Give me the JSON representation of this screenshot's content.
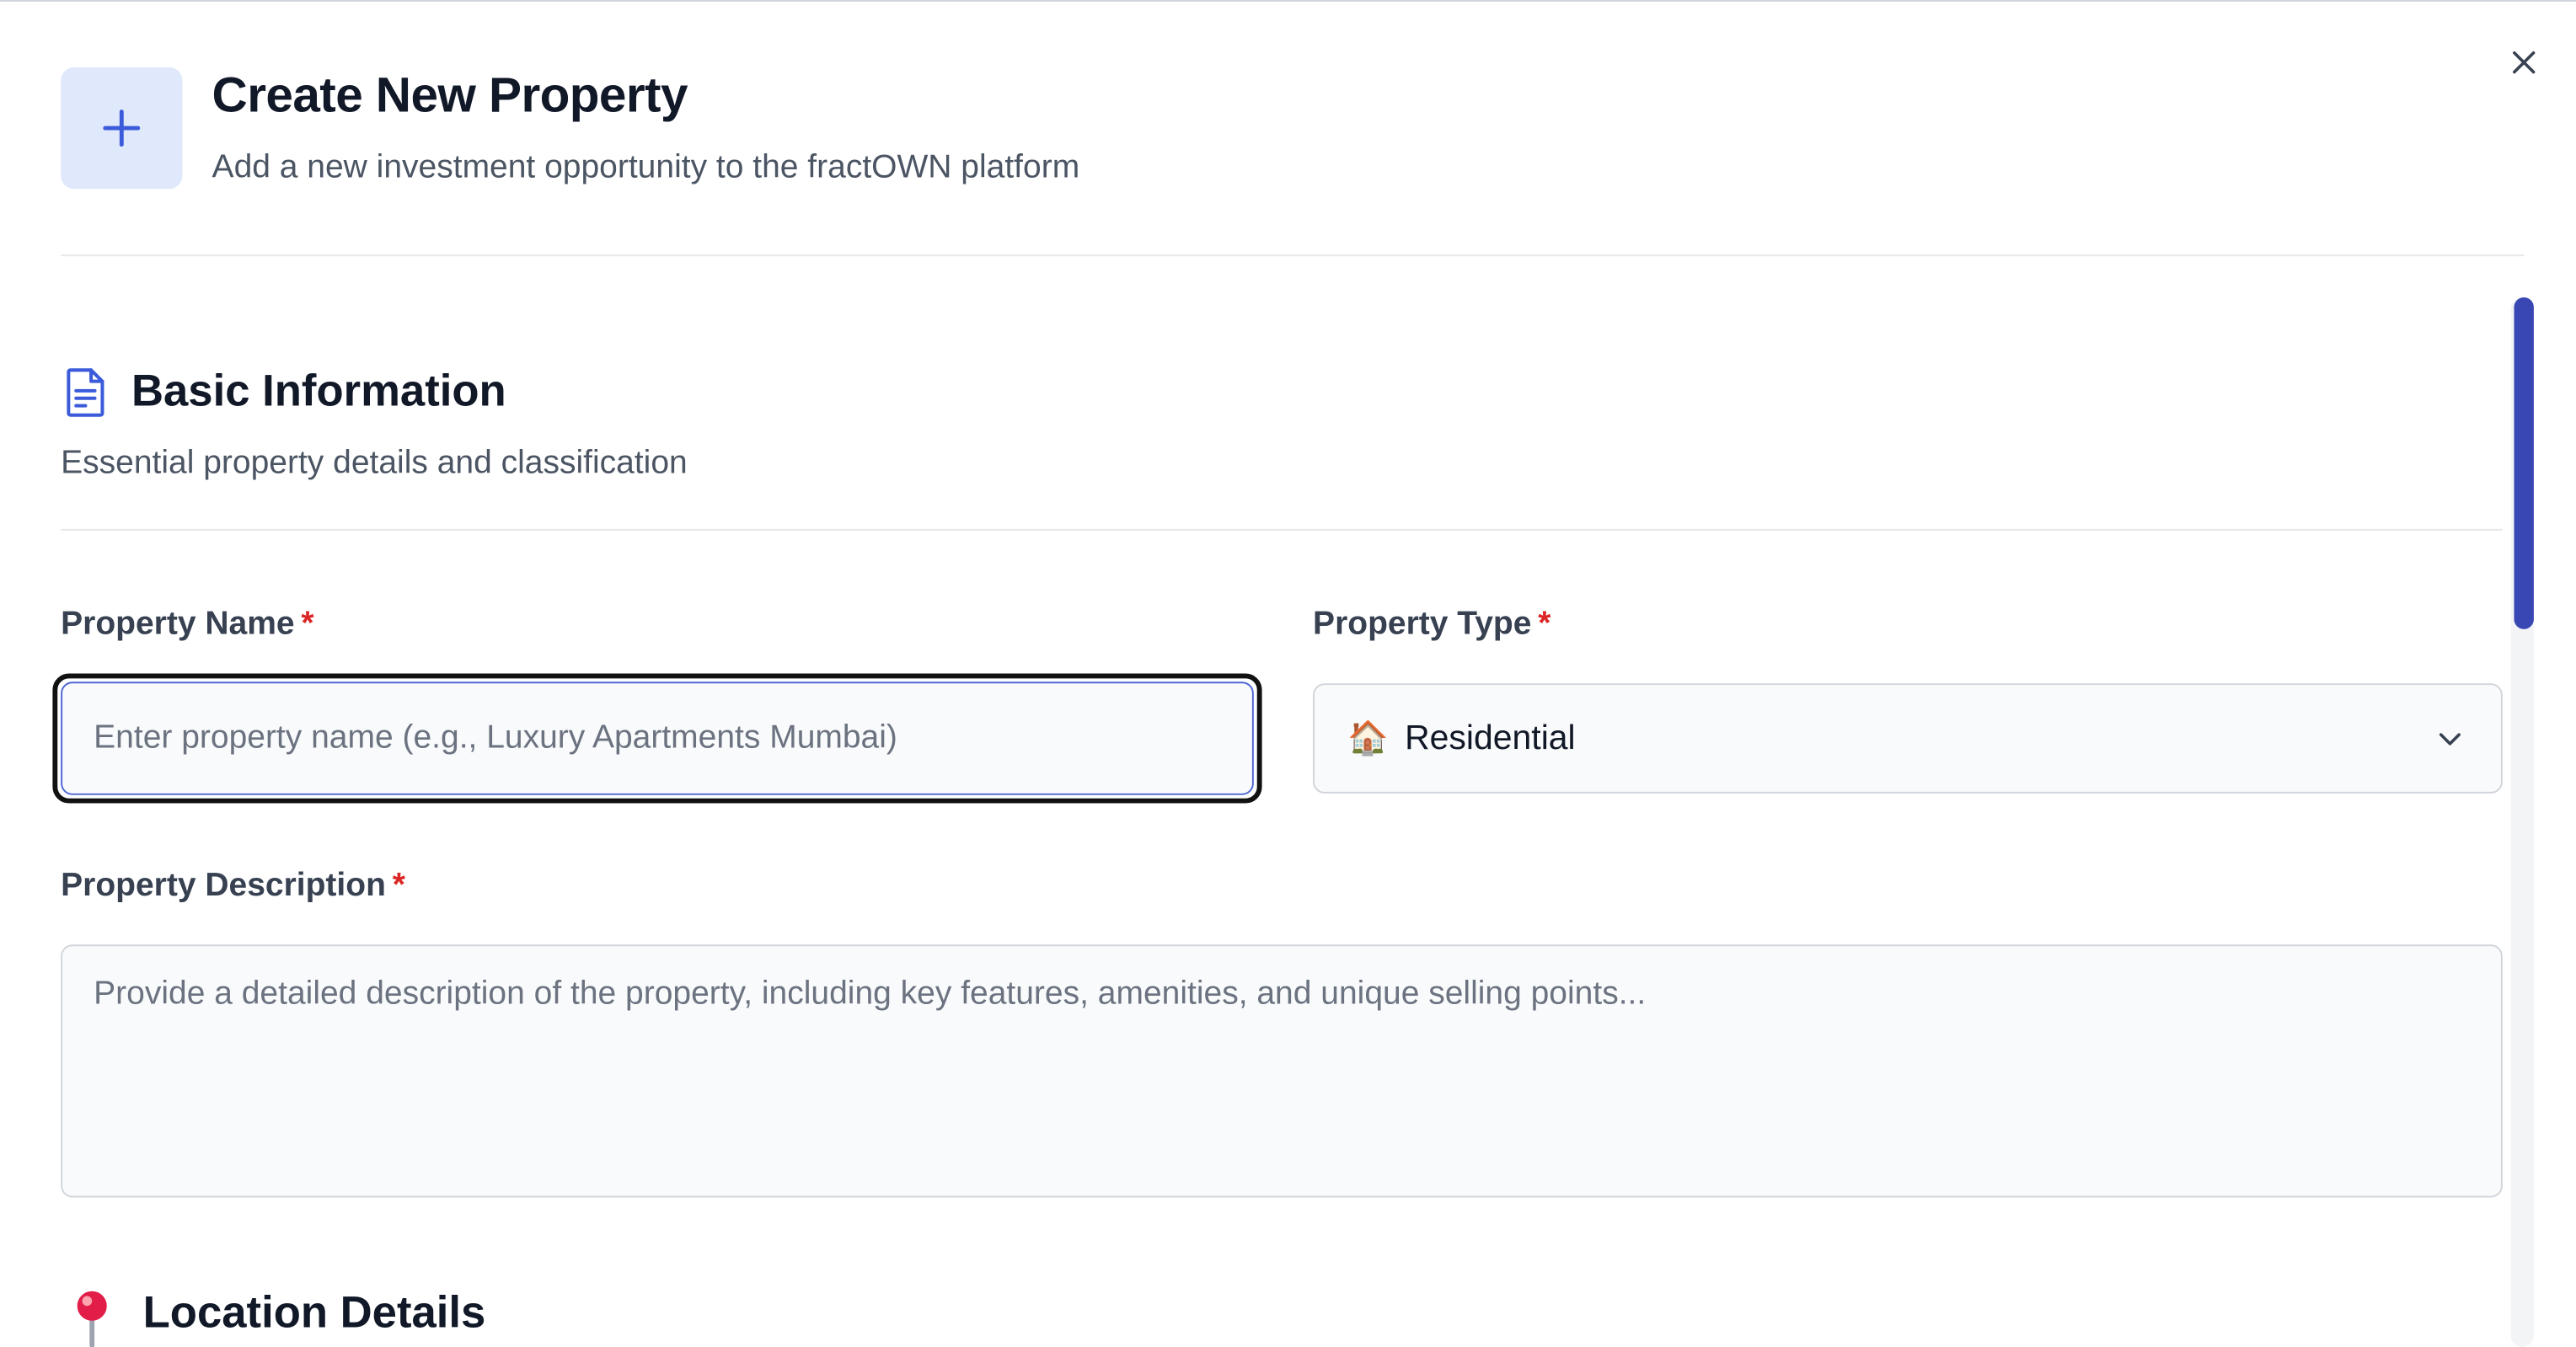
{
  "header": {
    "icon": "plus-icon",
    "title": "Create New Property",
    "subtitle": "Add a new investment opportunity to the fractOWN platform",
    "close_icon": "close-icon"
  },
  "basic_info": {
    "icon": "document-icon",
    "title": "Basic Information",
    "subtitle": "Essential property details and classification",
    "property_name": {
      "label": "Property Name",
      "required_mark": "*",
      "placeholder": "Enter property name (e.g., Luxury Apartments Mumbai)",
      "value": ""
    },
    "property_type": {
      "label": "Property Type",
      "required_mark": "*",
      "selected_emoji": "🏠",
      "selected": "Residential",
      "icon": "chevron-down-icon"
    },
    "property_description": {
      "label": "Property Description",
      "required_mark": "*",
      "placeholder": "Provide a detailed description of the property, including key features, amenities, and unique selling points...",
      "value": ""
    }
  },
  "location": {
    "icon": "map-pin-icon",
    "title": "Location Details"
  },
  "colors": {
    "accent": "#3947b4",
    "required": "#dc2626",
    "icon_bg": "#e0e9fb"
  }
}
